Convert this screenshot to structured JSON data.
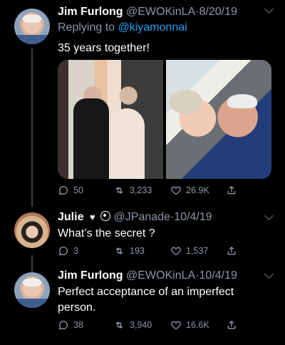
{
  "tweets": [
    {
      "name": "Jim Furlong",
      "handle": "@EWOKinLA",
      "separator": "·",
      "date": "8/20/19",
      "reply_prefix": "Replying to ",
      "reply_to": "@kiyamonnai",
      "text": "35 years together!",
      "stats": {
        "replies": "50",
        "retweets": "3,233",
        "likes": "26.9K"
      }
    },
    {
      "name": "Julie",
      "handle": "@JPanade",
      "separator": "·",
      "date": "10/4/19",
      "text": "What’s the secret ?",
      "stats": {
        "replies": "3",
        "retweets": "193",
        "likes": "1,537"
      }
    },
    {
      "name": "Jim Furlong",
      "handle": "@EWOKinLA",
      "separator": "·",
      "date": "10/4/19",
      "text_line1": "Perfect acceptance of an imperfect",
      "text_line2": "person.",
      "stats": {
        "replies": "38",
        "retweets": "3,940",
        "likes": "16.6K"
      }
    }
  ],
  "icons": {
    "reply": "reply-icon",
    "retweet": "retweet-icon",
    "like": "like-icon",
    "share": "share-icon",
    "more": "chevron-down-icon"
  },
  "colors": {
    "background": "#000000",
    "text": "#ffffff",
    "muted": "#8b98a5",
    "link": "#1da1f2",
    "thread_line": "#3d4146"
  }
}
